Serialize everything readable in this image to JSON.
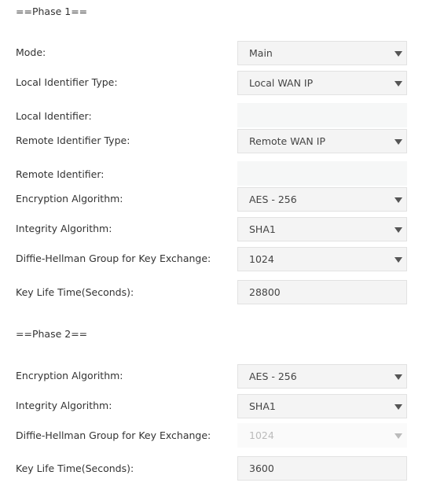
{
  "phase1": {
    "heading": "==Phase 1==",
    "mode": {
      "label": "Mode:",
      "value": "Main"
    },
    "local_id_type": {
      "label": "Local Identifier Type:",
      "value": "Local WAN IP"
    },
    "local_id": {
      "label": "Local Identifier:",
      "value": ""
    },
    "remote_id_type": {
      "label": "Remote Identifier Type:",
      "value": "Remote WAN IP"
    },
    "remote_id": {
      "label": "Remote Identifier:",
      "value": ""
    },
    "encryption": {
      "label": "Encryption Algorithm:",
      "value": "AES - 256"
    },
    "integrity": {
      "label": "Integrity Algorithm:",
      "value": "SHA1"
    },
    "dh_group": {
      "label": "Diffie-Hellman Group for Key Exchange:",
      "value": "1024"
    },
    "key_life": {
      "label": "Key Life Time(Seconds):",
      "value": "28800"
    }
  },
  "phase2": {
    "heading": "==Phase 2==",
    "encryption": {
      "label": "Encryption Algorithm:",
      "value": "AES - 256"
    },
    "integrity": {
      "label": "Integrity Algorithm:",
      "value": "SHA1"
    },
    "dh_group": {
      "label": "Diffie-Hellman Group for Key Exchange:",
      "value": "1024",
      "disabled": true
    },
    "key_life": {
      "label": "Key Life Time(Seconds):",
      "value": "3600"
    }
  }
}
